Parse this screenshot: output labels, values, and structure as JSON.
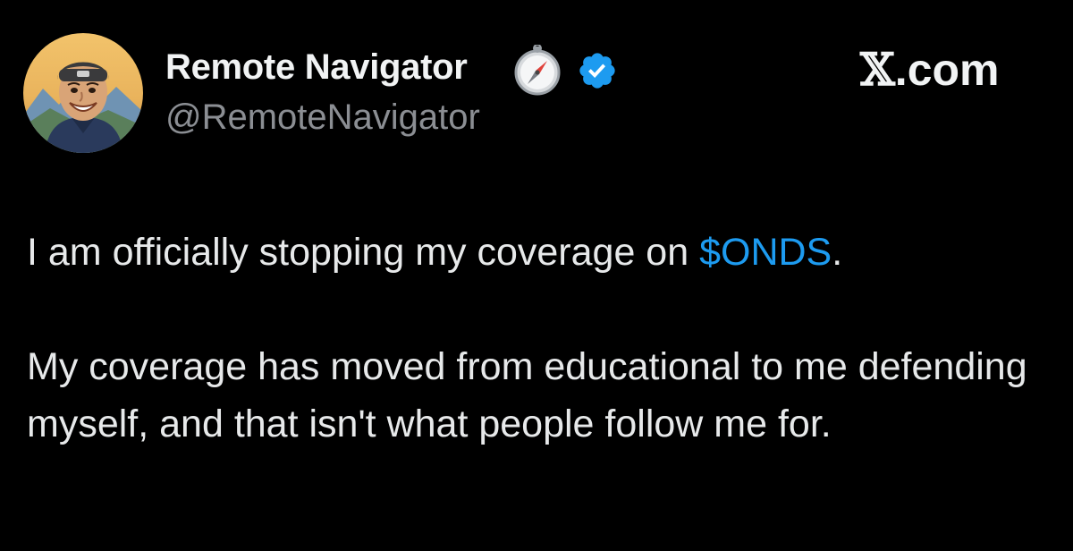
{
  "tweet": {
    "author": {
      "display_name": "Remote Navigator",
      "handle": "@RemoteNavigator",
      "name_emoji": "compass-emoji",
      "verified_icon": "verified-badge-icon",
      "verified_color": "#1d9bf0"
    },
    "site": {
      "x_glyph": "𝕏",
      "suffix": ".com"
    },
    "body": {
      "line1_prefix": "I am officially stopping my coverage on ",
      "cashtag": "$ONDS",
      "line1_suffix": ".",
      "paragraph2": "My coverage has moved from educational to me defending myself, and that isn't what people follow me for."
    }
  },
  "colors": {
    "background": "#000000",
    "text": "#e7e9ea",
    "secondary_text": "#8b8e93",
    "link": "#1d9bf0"
  }
}
